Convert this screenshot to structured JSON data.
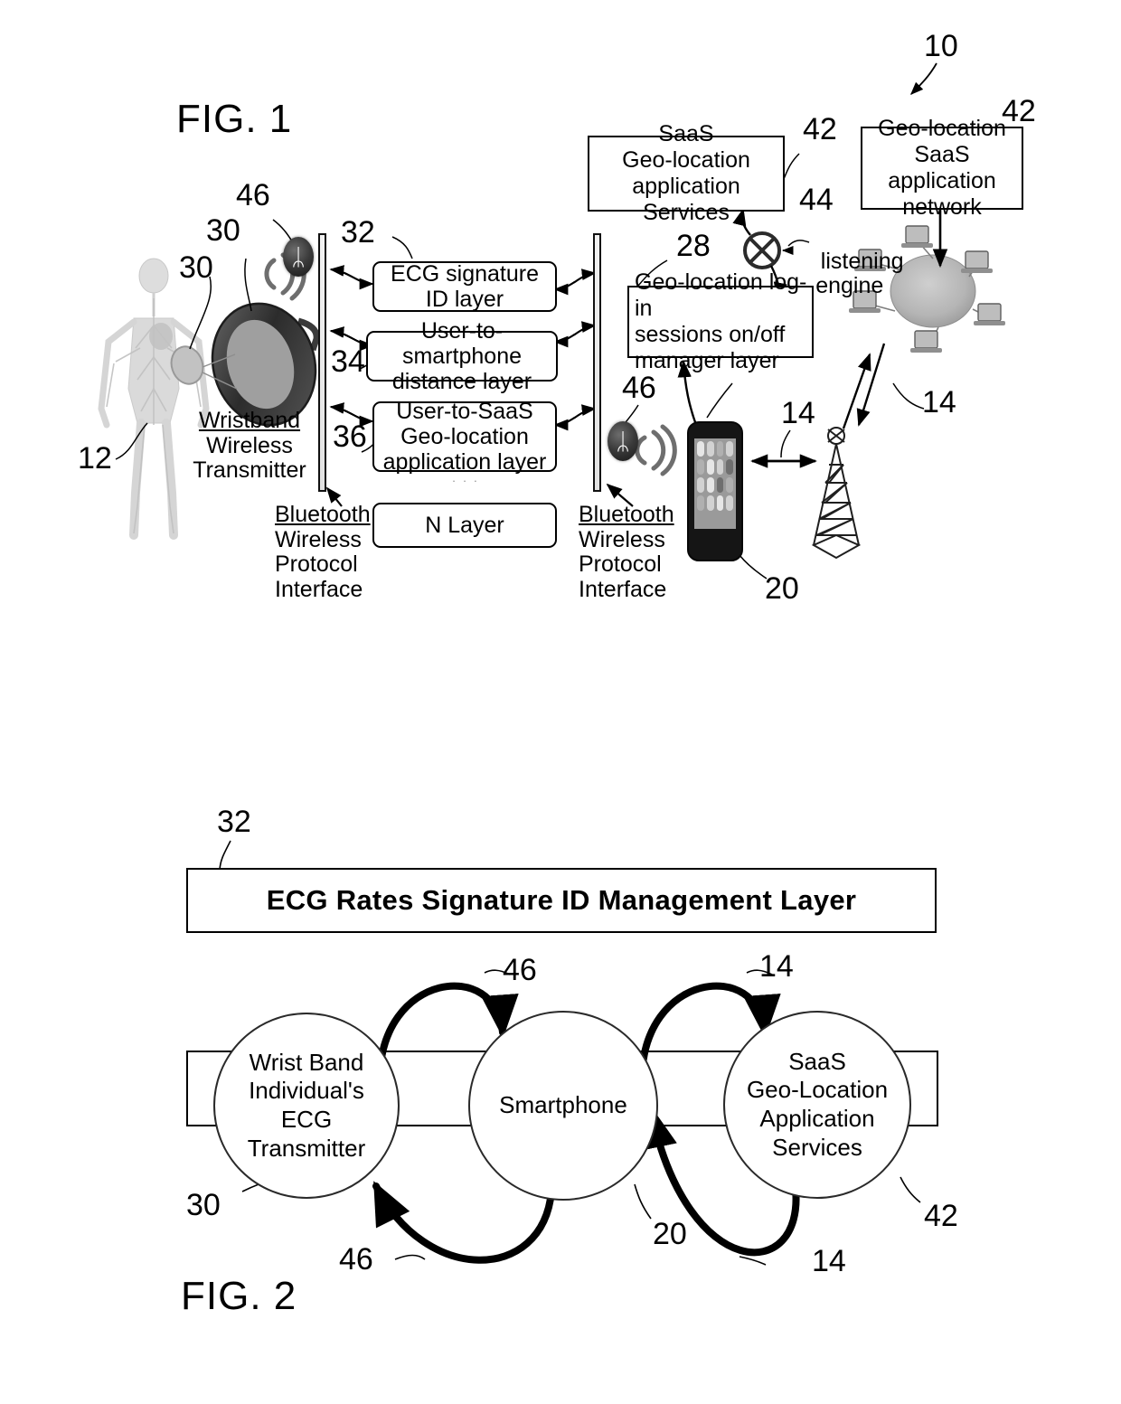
{
  "figures": {
    "fig1": {
      "title": "FIG. 1",
      "system_ref": "10",
      "boxes": {
        "ecg_signature": "ECG  signature\nID layer",
        "user_to_smartphone": "User-to-smartphone\ndistance layer",
        "user_to_saas": "User-to-SaaS\nGeo-location\napplication layer",
        "n_layer": "N Layer",
        "saas_services": "SaaS\nGeo-location\napplication Services",
        "geo_network": "Geo-location\nSaaS application\nnetwork",
        "session_manager": "Geo-location log-in\nsessions    on/off\nmanager  layer"
      },
      "labels": {
        "wristband_title": "Wristband",
        "wristband_sub": "Wireless\nTransmitter",
        "bluetooth_left": "Bluetooth",
        "bluetooth_left_sub": "Wireless\nProtocol\nInterface",
        "bluetooth_right": "Bluetooth",
        "bluetooth_right_sub": "Wireless\nProtocol\nInterface",
        "listening_engine": "listening\nengine",
        "ellipsis": "· · ·"
      },
      "refs": {
        "body": "12",
        "wristband_a": "30",
        "wristband_b": "30",
        "bt_left": "46",
        "layer32": "32",
        "layer34": "34",
        "layer36": "36",
        "session28": "28",
        "saas42": "42",
        "network42": "42",
        "listening44": "44",
        "bt_right46": "46",
        "phone20": "20",
        "link14_a": "14",
        "link14_b": "14",
        "system10": "10"
      },
      "icons": {
        "bluetooth_glyph": "ᛦ",
        "bluetooth_left_name": "bluetooth-icon",
        "bluetooth_right_name": "bluetooth-icon"
      }
    },
    "fig2": {
      "title": "FIG. 2",
      "banner": "ECG  Rates Signature ID Management Layer",
      "banner_ref": "32",
      "nodes": [
        {
          "id": "wristband",
          "text": "Wrist Band\nIndividual's\nECG\nTransmitter",
          "ref": "30"
        },
        {
          "id": "smartphone",
          "text": "Smartphone",
          "ref": "20"
        },
        {
          "id": "saas",
          "text": "SaaS\nGeo-Location\nApplication\nServices",
          "ref": "42"
        }
      ],
      "arrow_refs": {
        "top_left": "46",
        "top_right": "14",
        "bottom_left": "46",
        "bottom_right": "14"
      }
    }
  },
  "colors": {
    "ink": "#000000",
    "paper": "#ffffff",
    "bar_fill": "#e8e8e8"
  }
}
